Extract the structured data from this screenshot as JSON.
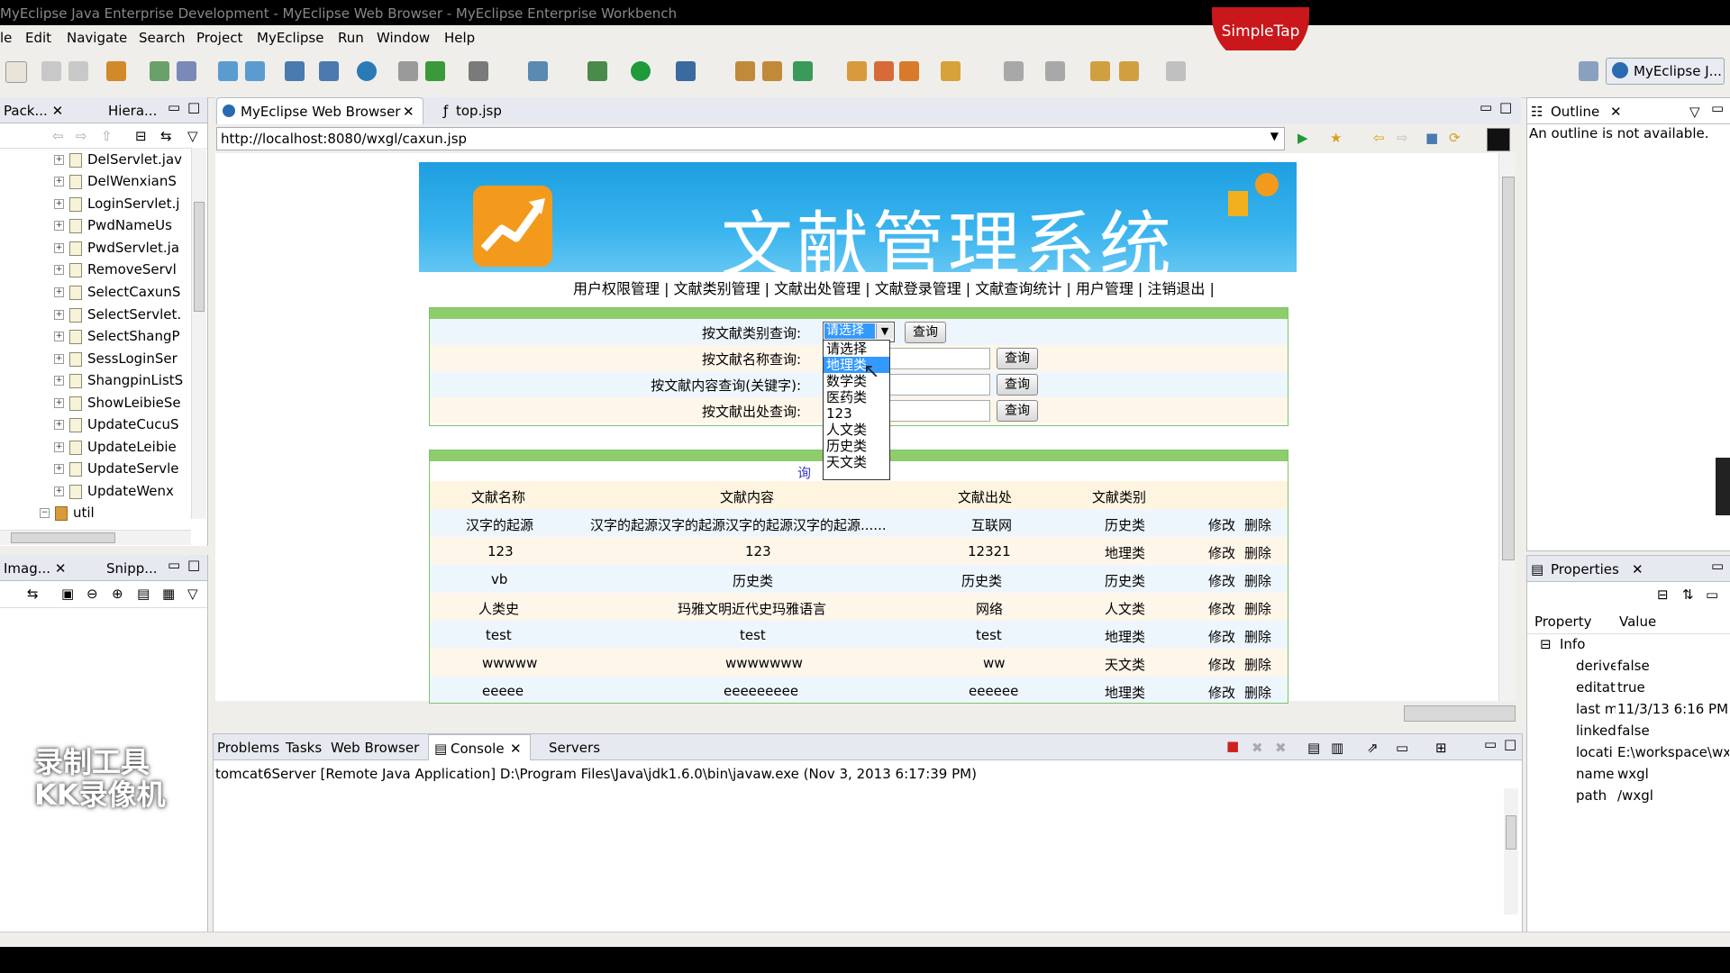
{
  "window": {
    "title": "MyEclipse Java Enterprise Development - MyEclipse Web Browser - MyEclipse Enterprise Workbench",
    "overlay_badge": "SimpleTap"
  },
  "menu": [
    "le",
    "Edit",
    "Navigate",
    "Search",
    "Project",
    "MyEclipse",
    "Run",
    "Window",
    "Help"
  ],
  "perspective": "MyEclipse J...",
  "left_panel": {
    "tabs": [
      "Pack...",
      "Hiera..."
    ],
    "tree": [
      "DelServlet.jav",
      "DelWenxianS",
      "LoginServlet.j",
      "PwdNameUs",
      "PwdServlet.ja",
      "RemoveServl",
      "SelectCaxunS",
      "SelectServlet.",
      "SelectShangP",
      "SessLoginSer",
      "ShangpinListS",
      "ShowLeibieSe",
      "UpdateCucuS",
      "UpdateLeibie",
      "UpdateServle",
      "UpdateWenx",
      "util"
    ]
  },
  "left_bottom_panel": {
    "tabs": [
      "Imag...",
      "Snipp..."
    ]
  },
  "editor": {
    "tabs": [
      "MyEclipse Web Browser",
      "top.jsp"
    ],
    "url": "http://localhost:8080/wxgl/caxun.jsp"
  },
  "webpage": {
    "banner_title": "文献管理系统",
    "nav": "用户权限管理 | 文献类别管理 | 文献出处管理 | 文献登录管理 | 文献查询统计 | 用户管理 | 注销退出 |",
    "form": {
      "row1_label": "按文献类别查询:",
      "row2_label": "按文献名称查询:",
      "row3_label": "按文献内容查询(关键字):",
      "row4_label": "按文献出处查询:",
      "select_value": "请选择",
      "query_btn": "查询"
    },
    "dropdown_options": [
      "请选择",
      "地理类",
      "数学类",
      "医药类",
      "123",
      "人文类",
      "历史类",
      "天文类"
    ],
    "table_title_fragment": "询",
    "table_headers": [
      "文献名称",
      "文献内容",
      "文献出处",
      "文献类别"
    ],
    "rows": [
      [
        "汉字的起源",
        "汉字的起源汉字的起源汉字的起源汉字的起源......",
        "互联网",
        "历史类"
      ],
      [
        "123",
        "123",
        "12321",
        "地理类"
      ],
      [
        "vb",
        "历史类",
        "历史类",
        "历史类"
      ],
      [
        "人类史",
        "玛雅文明近代史玛雅语言",
        "网络",
        "人文类"
      ],
      [
        "test",
        "test",
        "test",
        "地理类"
      ],
      [
        "wwwww",
        "wwwwwww",
        "ww",
        "天文类"
      ],
      [
        "eeeee",
        "eeeeeeeee",
        "eeeeee",
        "地理类"
      ]
    ],
    "edit_label": "修改",
    "delete_label": "删除"
  },
  "outline": {
    "title": "Outline",
    "message": "An outline is not available."
  },
  "properties": {
    "title": "Properties",
    "col_property": "Property",
    "col_value": "Value",
    "group": "Info",
    "items": [
      [
        "derive",
        "false"
      ],
      [
        "editat",
        "true"
      ],
      [
        "last m",
        "11/3/13 6:16 PM"
      ],
      [
        "linked",
        "false"
      ],
      [
        "locati",
        "E:\\workspace\\wx."
      ],
      [
        "name",
        "wxgl"
      ],
      [
        "path",
        "/wxgl"
      ]
    ]
  },
  "console": {
    "tabs": [
      "Problems",
      "Tasks",
      "Web Browser",
      "Console",
      "Servers"
    ],
    "line": "tomcat6Server [Remote Java Application] D:\\Program Files\\Java\\jdk1.6.0\\bin\\javaw.exe (Nov 3, 2013 6:17:39 PM)"
  },
  "watermark": [
    "录制工具",
    "KK录像机"
  ]
}
